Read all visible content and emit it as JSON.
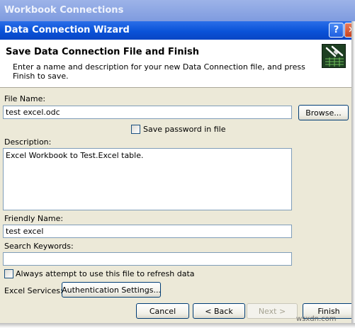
{
  "parent_window": {
    "title": "Workbook Connections"
  },
  "dialog": {
    "title": "Data Connection Wizard",
    "help_glyph": "?",
    "close_glyph": "✕"
  },
  "header": {
    "title": "Save Data Connection File and Finish",
    "description": "Enter a name and description for your new Data Connection file, and press Finish to save.",
    "icon": "wizard-connection-icon"
  },
  "form": {
    "file_name": {
      "label": "File Name:",
      "value": "test excel.odc"
    },
    "browse_label": "Browse...",
    "save_password": {
      "label": "Save password in file",
      "checked": false
    },
    "description": {
      "label": "Description:",
      "value": "Excel Workbook to Test.Excel table."
    },
    "friendly_name": {
      "label": "Friendly Name:",
      "value": "test excel"
    },
    "search_keywords": {
      "label": "Search Keywords:",
      "value": ""
    },
    "always_attempt": {
      "label": "Always attempt to use this file to refresh data",
      "checked": false
    },
    "excel_services_label": "Excel Services:",
    "auth_settings_label": "Authentication Settings..."
  },
  "footer": {
    "cancel_label": "Cancel",
    "back_label": "< Back",
    "next_label": "Next >",
    "finish_label": "Finish"
  },
  "watermark": "wsxdn.com",
  "colors": {
    "titlebar": "#0a52d8",
    "dialog_bg": "#ece9d8",
    "input_border": "#7f9db9"
  }
}
